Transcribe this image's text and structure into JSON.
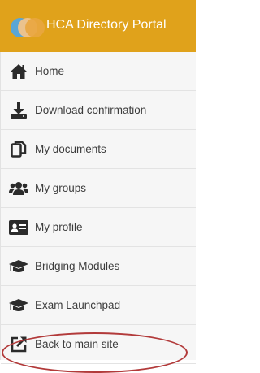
{
  "header": {
    "title": "HCA Directory Portal",
    "logo_icon": "hca-logo-icon",
    "background": "#e0a21b"
  },
  "nav": {
    "items": [
      {
        "label": "Home",
        "icon": "home-icon"
      },
      {
        "label": "Download confirmation",
        "icon": "download-icon"
      },
      {
        "label": "My documents",
        "icon": "documents-icon"
      },
      {
        "label": "My groups",
        "icon": "groups-icon"
      },
      {
        "label": "My profile",
        "icon": "profile-card-icon"
      },
      {
        "label": "Bridging Modules",
        "icon": "graduation-cap-icon"
      },
      {
        "label": "Exam Launchpad",
        "icon": "graduation-cap-icon"
      },
      {
        "label": "Back to main site",
        "icon": "external-link-icon"
      }
    ]
  },
  "annotation": {
    "highlight_color": "#b23a3a",
    "highlighted_item": "Exam Launchpad"
  }
}
